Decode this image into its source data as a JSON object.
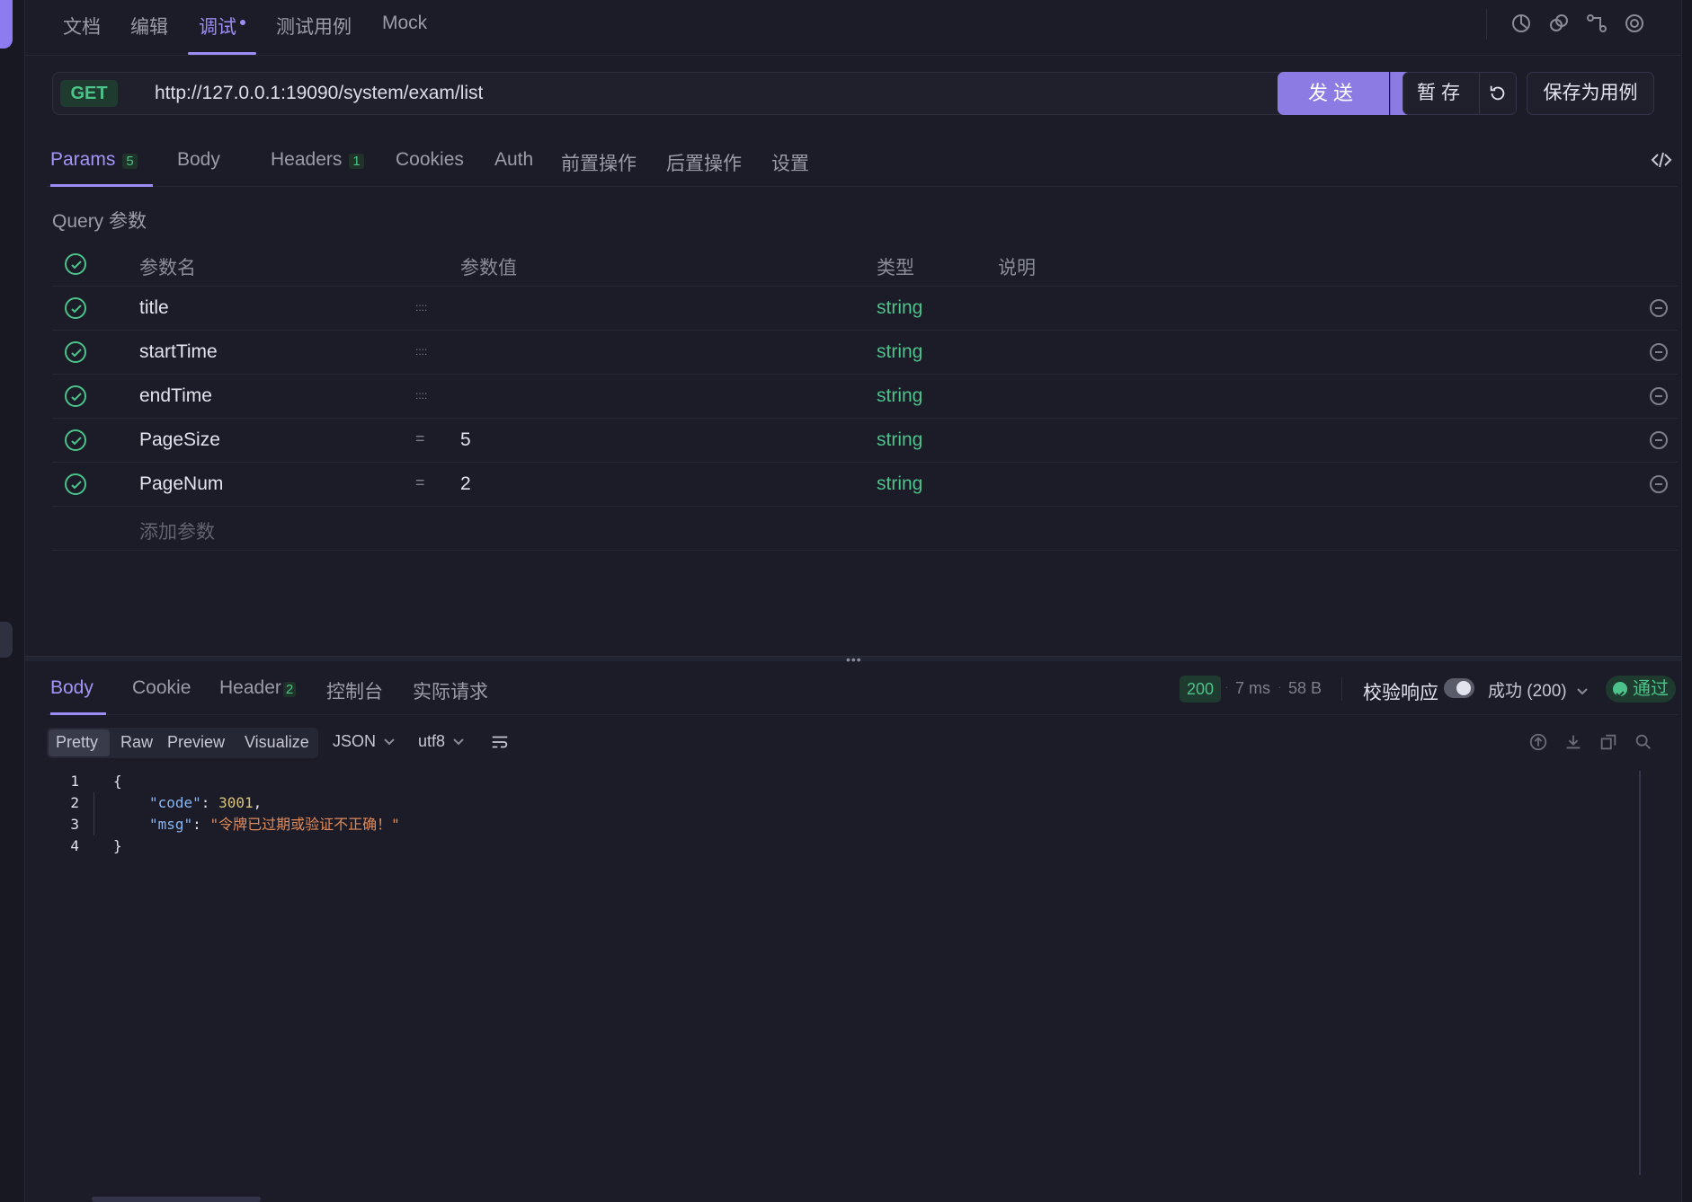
{
  "top_tabs": [
    "文档",
    "编辑",
    "调试",
    "测试用例",
    "Mock"
  ],
  "request": {
    "method": "GET",
    "url": "http://127.0.0.1:19090/system/exam/list",
    "send_label": "发送",
    "temp_save_label": "暂存",
    "save_case_label": "保存为用例"
  },
  "param_tabs": {
    "params": "Params",
    "params_count": "5",
    "body": "Body",
    "headers": "Headers",
    "headers_count": "1",
    "cookies": "Cookies",
    "auth": "Auth",
    "pre": "前置操作",
    "post": "后置操作",
    "settings": "设置"
  },
  "query_label": "Query 参数",
  "table_header": {
    "name": "参数名",
    "value": "参数值",
    "type": "类型",
    "desc": "说明"
  },
  "params": [
    {
      "name": "title",
      "op": "::::",
      "value": "",
      "type": "string"
    },
    {
      "name": "startTime",
      "op": "::::",
      "value": "",
      "type": "string"
    },
    {
      "name": "endTime",
      "op": "::::",
      "value": "",
      "type": "string"
    },
    {
      "name": "PageSize",
      "op": "=",
      "value": "5",
      "type": "string"
    },
    {
      "name": "PageNum",
      "op": "=",
      "value": "2",
      "type": "string"
    }
  ],
  "add_param_label": "添加参数",
  "response_tabs": {
    "body": "Body",
    "cookie": "Cookie",
    "header": "Header",
    "header_count": "2",
    "console": "控制台",
    "actual": "实际请求"
  },
  "response_meta": {
    "status": "200",
    "time": "7 ms",
    "size": "58 B",
    "verify_label": "校验响应",
    "verify_on": true,
    "success_option": "成功 (200)",
    "pass_label": "通过"
  },
  "view_modes": [
    "Pretty",
    "Raw",
    "Preview",
    "Visualize"
  ],
  "active_view": "Pretty",
  "format": "JSON",
  "encoding": "utf8",
  "code_lines": [
    {
      "n": "1",
      "text": "{"
    },
    {
      "n": "2",
      "key": "\"code\"",
      "num": "3001",
      "tail": ","
    },
    {
      "n": "3",
      "key": "\"msg\"",
      "str": "\"令牌已过期或验证不正确！\""
    },
    {
      "n": "4",
      "text": "}"
    }
  ],
  "colors": {
    "accent": "#8b7be3",
    "success": "#4cc38a",
    "background": "#1b1c27"
  }
}
